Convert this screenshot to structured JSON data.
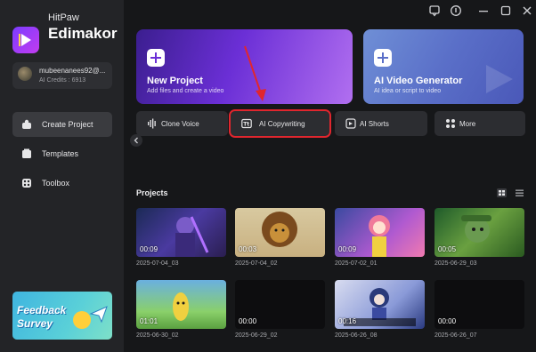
{
  "brand": {
    "top": "HitPaw",
    "name": "Edimakor"
  },
  "account": {
    "name": "mubeenanees92@...",
    "credits": "AI Credits : 6913"
  },
  "nav": [
    {
      "label": "Create Project",
      "icon": "create-project-icon",
      "active": true
    },
    {
      "label": "Templates",
      "icon": "templates-icon",
      "active": false
    },
    {
      "label": "Toolbox",
      "icon": "toolbox-icon",
      "active": false
    }
  ],
  "feedback": {
    "line1": "Feedback",
    "line2": "Survey"
  },
  "cards": {
    "new_project": {
      "title": "New Project",
      "sub": "Add files and create a video"
    },
    "ai_video": {
      "title": "AI Video Generator",
      "sub": "AI idea or script to video"
    }
  },
  "features": [
    {
      "label": "Clone Voice",
      "icon": "waveform-icon"
    },
    {
      "label": "AI Copywriting",
      "icon": "text-box-icon"
    },
    {
      "label": "AI Shorts",
      "icon": "ai-shorts-icon"
    },
    {
      "label": "More",
      "icon": "grid-dots-icon"
    }
  ],
  "projects": {
    "title": "Projects",
    "items": [
      {
        "duration": "00:09",
        "name": "2025-07-04_03"
      },
      {
        "duration": "00:03",
        "name": "2025-07-04_02"
      },
      {
        "duration": "00:09",
        "name": "2025-07-02_01"
      },
      {
        "duration": "00:05",
        "name": "2025-06-29_03"
      },
      {
        "duration": "01:01",
        "name": "2025-06-30_02"
      },
      {
        "duration": "00:00",
        "name": "2025-06-29_02"
      },
      {
        "duration": "00:16",
        "name": "2025-06-26_08"
      },
      {
        "duration": "00:00",
        "name": "2025-06-26_07"
      }
    ]
  },
  "colors": {
    "sidebar": "#232427",
    "background": "#161719",
    "highlight": "#e0262e",
    "accent": "#6b2fd6"
  }
}
